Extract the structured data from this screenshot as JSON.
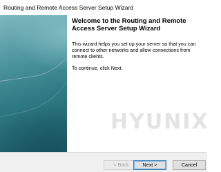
{
  "window": {
    "title": "Routing and Remote Access Server Setup Wizard"
  },
  "wizard": {
    "heading": "Welcome to the Routing and Remote Access Server Setup Wizard",
    "description": "This wizard helps you set up your server so that you can connect to other networks and allow connections from remote clients.",
    "instruction": "To continue, click Next."
  },
  "watermark": {
    "text": "HYUNIX"
  },
  "buttons": {
    "back": "< Back",
    "next": "Next >",
    "cancel": "Cancel",
    "back_enabled": false
  },
  "colors": {
    "banner_top": "#7eb8bf",
    "banner_bottom": "#1e5f69",
    "footer": "#f0f0f0"
  }
}
